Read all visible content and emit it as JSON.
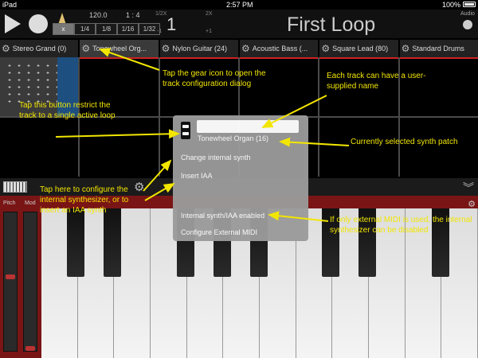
{
  "status": {
    "carrier": "iPad",
    "time": "2:57 PM",
    "battery": "100%"
  },
  "transport": {
    "tempo": "120.0",
    "time_signature": "1 : 4",
    "quantize": [
      "x",
      "1/4",
      "1/8",
      "1/16",
      "1/32"
    ],
    "half_label": "1/2X",
    "double_label": "2X",
    "minus_label": "-1",
    "plus_label": "+1",
    "loop_count": "1",
    "loop_title": "First Loop",
    "audio_label": "Audio"
  },
  "tracks": [
    {
      "name": "Stereo Grand (0)"
    },
    {
      "name": "Tonewheel Org..."
    },
    {
      "name": "Nylon Guitar (24)"
    },
    {
      "name": "Acoustic Bass (..."
    },
    {
      "name": "Square Lead (80)"
    },
    {
      "name": "Standard Drums"
    }
  ],
  "keyboard": {
    "pitch_label": "Pitch",
    "mod_label": "Mod"
  },
  "dialog": {
    "name_value": "",
    "patch": "Tonewheel Organ (16)",
    "items": {
      "change_synth": "Change internal synth",
      "insert_iaa": "Insert IAA",
      "synth_enabled": "Internal synth/IAA enabled",
      "configure_midi": "Configure External MIDI"
    }
  },
  "annotations": {
    "gear": "Tap the gear icon to open the track configuration dialog",
    "name": "Each track can have a user-supplied name",
    "restrict": "Tap this button restrict the track to a single active loop",
    "patch": "Currently selected synth patch",
    "configure": "Tap here to configure the internal synthesizer, or to insert an IAA synth",
    "external": "If only external MIDI is used, the internal synthesizer can be disabled"
  },
  "colors": {
    "annotation": "#f2e600",
    "keyboard_panel": "#7a1515",
    "accent_blue": "#1d4f80"
  }
}
